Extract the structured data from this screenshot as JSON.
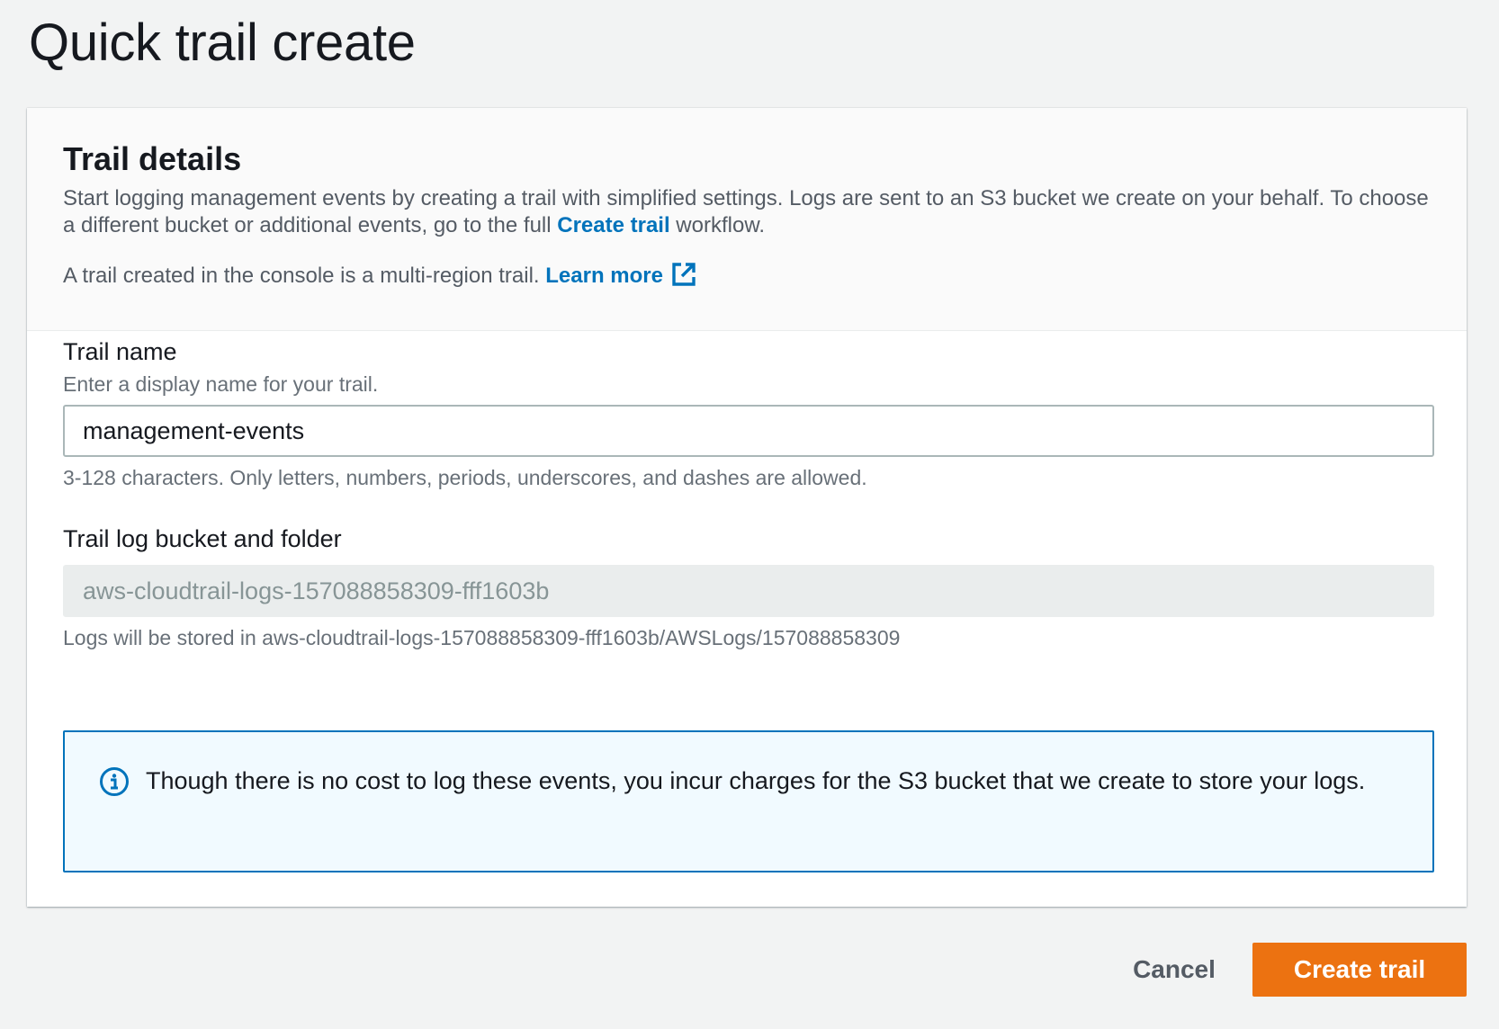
{
  "page": {
    "title": "Quick trail create"
  },
  "trail_details": {
    "title": "Trail details",
    "description_before_link": "Start logging management events by creating a trail with simplified settings. Logs are sent to an S3 bucket we create on your behalf. To choose a different bucket or additional events, go to the full ",
    "create_trail_link": "Create trail",
    "description_after_link": " workflow.",
    "multi_region_text": "A trail created in the console is a multi-region trail. ",
    "learn_more_link": "Learn more",
    "learn_more_icon": "external-link-icon"
  },
  "trail_name": {
    "label": "Trail name",
    "description": "Enter a display name for your trail.",
    "value": "management-events",
    "constraint": "3-128 characters. Only letters, numbers, periods, underscores, and dashes are allowed."
  },
  "bucket": {
    "label": "Trail log bucket and folder",
    "value": "aws-cloudtrail-logs-157088858309-fff1603b",
    "hint": "Logs will be stored in aws-cloudtrail-logs-157088858309-fff1603b/AWSLogs/157088858309"
  },
  "info_alert": {
    "icon": "info-icon",
    "text": "Though there is no cost to log these events, you incur charges for the S3 bucket that we create to store your logs."
  },
  "actions": {
    "cancel_label": "Cancel",
    "create_label": "Create trail"
  },
  "colors": {
    "link": "#0073bb",
    "primary_button": "#ec7211",
    "info_border": "#0073bb",
    "info_background": "#f1faff"
  }
}
